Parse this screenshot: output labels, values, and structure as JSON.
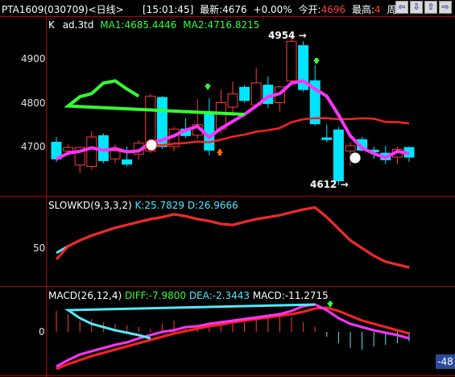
{
  "header": {
    "title": "PTA1609(030709)<日线>",
    "time": "[15:01:45]",
    "last_label": "最新:",
    "last_value": "4676",
    "change": "+0.00%",
    "open_label": "今开:",
    "open_value": "4696",
    "high_label": "最高:",
    "high_value": "4",
    "period_label": "周期"
  },
  "nav": {
    "prev": "⇦",
    "down": "⇩",
    "up": "⇧",
    "next": "⇨"
  },
  "main_pane": {
    "indicator": "K",
    "adjust": "ad.3td",
    "ma1": "MA1:4685.4446",
    "ma2": "MA2:4716.8215",
    "y_labels": [
      "4900",
      "4800",
      "4700"
    ],
    "high_marker": "4954",
    "low_marker": "4612"
  },
  "kd_pane": {
    "name": "SLOWKD(9,3,3,2)",
    "k": "K:25.7829",
    "d": "D:26.9666",
    "y_label": "50"
  },
  "macd_pane": {
    "name": "MACD(26,12,4)",
    "diff": "DIFF:-7.9800",
    "dea": "DEA:-2.3443",
    "macd": "MACD:-11.2715",
    "y_label": "0"
  },
  "badge": "-48",
  "colors": {
    "up": "#ff3c3c",
    "down": "#00e5ff",
    "grid": "#b40000",
    "ma1": "#ff33ff",
    "ma2": "#ff2222"
  },
  "chart_data": {
    "type": "candlestick",
    "ylim": [
      4600,
      5010
    ],
    "candles": [
      {
        "o": 4710,
        "h": 4722,
        "l": 4665,
        "c": 4672
      },
      {
        "o": 4690,
        "h": 4705,
        "l": 4680,
        "c": 4698
      },
      {
        "o": 4658,
        "h": 4700,
        "l": 4640,
        "c": 4698
      },
      {
        "o": 4655,
        "h": 4735,
        "l": 4648,
        "c": 4722
      },
      {
        "o": 4725,
        "h": 4730,
        "l": 4662,
        "c": 4668
      },
      {
        "o": 4672,
        "h": 4705,
        "l": 4662,
        "c": 4692
      },
      {
        "o": 4670,
        "h": 4700,
        "l": 4655,
        "c": 4660
      },
      {
        "o": 4683,
        "h": 4715,
        "l": 4670,
        "c": 4708
      },
      {
        "o": 4690,
        "h": 4820,
        "l": 4685,
        "c": 4815
      },
      {
        "o": 4812,
        "h": 4815,
        "l": 4695,
        "c": 4700
      },
      {
        "o": 4700,
        "h": 4745,
        "l": 4690,
        "c": 4740
      },
      {
        "o": 4740,
        "h": 4765,
        "l": 4720,
        "c": 4725
      },
      {
        "o": 4726,
        "h": 4808,
        "l": 4718,
        "c": 4750
      },
      {
        "o": 4778,
        "h": 4810,
        "l": 4680,
        "c": 4692
      },
      {
        "o": 4740,
        "h": 4830,
        "l": 4730,
        "c": 4800
      },
      {
        "o": 4790,
        "h": 4848,
        "l": 4776,
        "c": 4820
      },
      {
        "o": 4835,
        "h": 4840,
        "l": 4800,
        "c": 4805
      },
      {
        "o": 4795,
        "h": 4880,
        "l": 4790,
        "c": 4845
      },
      {
        "o": 4840,
        "h": 4860,
        "l": 4788,
        "c": 4798
      },
      {
        "o": 4800,
        "h": 4838,
        "l": 4780,
        "c": 4836
      },
      {
        "o": 4850,
        "h": 4954,
        "l": 4845,
        "c": 4940
      },
      {
        "o": 4930,
        "h": 4940,
        "l": 4825,
        "c": 4830
      },
      {
        "o": 4850,
        "h": 4885,
        "l": 4748,
        "c": 4752
      },
      {
        "o": 4720,
        "h": 4750,
        "l": 4710,
        "c": 4716
      },
      {
        "o": 4738,
        "h": 4745,
        "l": 4612,
        "c": 4622
      },
      {
        "o": 4690,
        "h": 4710,
        "l": 4655,
        "c": 4702
      },
      {
        "o": 4716,
        "h": 4722,
        "l": 4690,
        "c": 4692
      },
      {
        "o": 4692,
        "h": 4700,
        "l": 4672,
        "c": 4688
      },
      {
        "o": 4685,
        "h": 4702,
        "l": 4660,
        "c": 4670
      },
      {
        "o": 4676,
        "h": 4700,
        "l": 4660,
        "c": 4694
      },
      {
        "o": 4698,
        "h": 4700,
        "l": 4665,
        "c": 4676
      }
    ]
  }
}
